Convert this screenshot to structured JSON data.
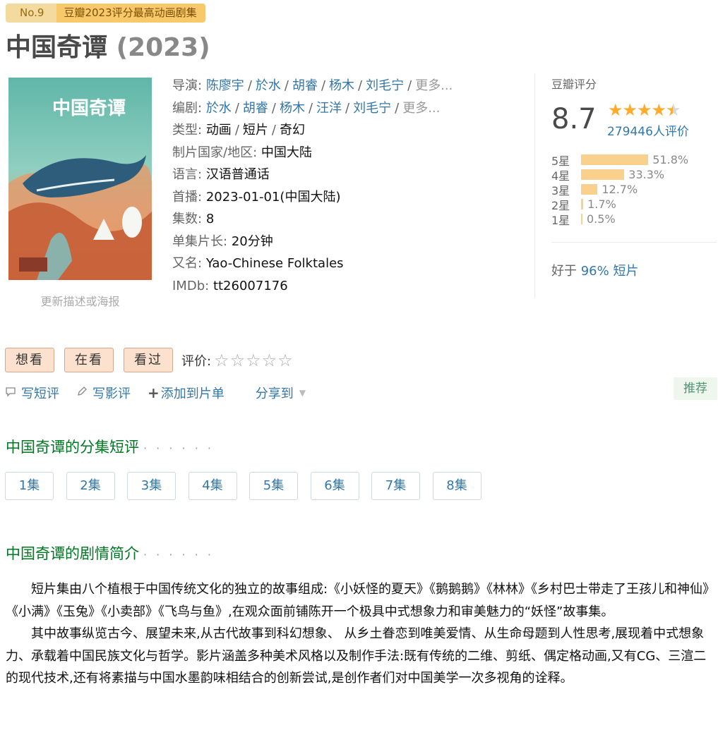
{
  "rank": {
    "no": "No.9",
    "text": "豆瓣2023评分最高动画剧集"
  },
  "title": {
    "name": "中国奇谭",
    "year": "(2023)"
  },
  "poster": {
    "update_link": "更新描述或海报"
  },
  "info": {
    "director_label": "导演:",
    "directors": [
      "陈廖宇",
      "於水",
      "胡睿",
      "杨木",
      "刘毛宁"
    ],
    "director_more": "更多...",
    "writer_label": "编剧:",
    "writers": [
      "於水",
      "胡睿",
      "杨木",
      "汪洋",
      "刘毛宁"
    ],
    "writer_more": "更多...",
    "genre_label": "类型:",
    "genres": [
      "动画",
      "短片",
      "奇幻"
    ],
    "country_label": "制片国家/地区:",
    "country": "中国大陆",
    "language_label": "语言:",
    "language": "汉语普通话",
    "premiere_label": "首播:",
    "premiere": "2023-01-01(中国大陆)",
    "episodes_label": "集数:",
    "episodes": "8",
    "runtime_label": "单集片长:",
    "runtime": "20分钟",
    "aka_label": "又名:",
    "aka": "Yao-Chinese Folktales",
    "imdb_label": "IMDb:",
    "imdb": "tt26007176"
  },
  "rating": {
    "header": "豆瓣评分",
    "score": "8.7",
    "stars": 4.5,
    "votes": "279446人评价",
    "histogram": [
      {
        "label": "5星",
        "percent": "51.8%",
        "value": 51.8
      },
      {
        "label": "4星",
        "percent": "33.3%",
        "value": 33.3
      },
      {
        "label": "3星",
        "percent": "12.7%",
        "value": 12.7
      },
      {
        "label": "2星",
        "percent": "1.7%",
        "value": 1.7
      },
      {
        "label": "1星",
        "percent": "0.5%",
        "value": 0.5
      }
    ],
    "better_prefix": "好于",
    "better_link": "96% 短片"
  },
  "actions": {
    "want": "想看",
    "watching": "在看",
    "watched": "看过",
    "rate_label": "评价:",
    "write_short": "写短评",
    "write_review": "写影评",
    "add_to_list": "添加到片单",
    "share": "分享到",
    "recommend": "推荐"
  },
  "episodes_section": {
    "title": "中国奇谭的分集短评",
    "dots": "· · · · · ·",
    "items": [
      "1集",
      "2集",
      "3集",
      "4集",
      "5集",
      "6集",
      "7集",
      "8集"
    ]
  },
  "summary_section": {
    "title": "中国奇谭的剧情简介",
    "dots": "· · · · · ·",
    "paragraphs": [
      "短片集由八个植根于中国传统文化的独立的故事组成:《小妖怪的夏天》《鹅鹅鹅》《林林》《乡村巴士带走了王孩儿和神仙》《小满》《玉兔》《小卖部》《飞鸟与鱼》,在观众面前铺陈开一个极具中式想象力和审美魅力的“妖怪”故事集。",
      "其中故事纵览古今、展望未来,从古代故事到科幻想象、 从乡土眷恋到唯美爱情、从生命母题到人性思考,展现着中式想象力、承载着中国民族文化与哲学。影片涵盖多种美术风格以及制作手法:既有传统的二维、剪纸、偶定格动画,又有CG、三渲二的现代技术,还有将素描与中国水墨韵味相结合的创新尝试,是创作者们对中国美学一次多视角的诠释。"
    ]
  },
  "colors": {
    "link": "#3377aa",
    "section_title": "#007722",
    "star": "#ffac2d",
    "bar": "#f9d18c",
    "rank_bg": "#f7c96a"
  }
}
